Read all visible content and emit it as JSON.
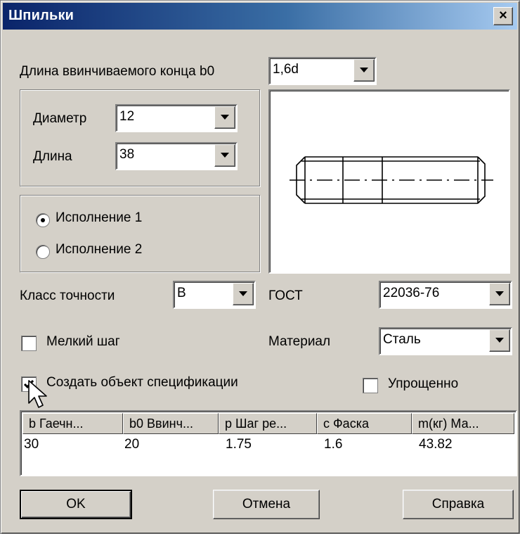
{
  "window": {
    "title": "Шпильки",
    "close_label": "×"
  },
  "b0": {
    "label": "Длина ввинчиваемого конца b0",
    "value": "1,6d"
  },
  "dims": {
    "diameter_label": "Диаметр",
    "diameter_value": "12",
    "length_label": "Длина",
    "length_value": "38"
  },
  "execution": {
    "option1": "Исполнение 1",
    "option2": "Исполнение 2",
    "selected": 1
  },
  "accuracy": {
    "label": "Класс точности",
    "value": "В"
  },
  "gost": {
    "label": "ГОСТ",
    "value": "22036-76"
  },
  "fine_pitch": {
    "label": "Мелкий шаг",
    "checked": false
  },
  "material": {
    "label": "Материал",
    "value": "Сталь"
  },
  "spec": {
    "label": "Создать объект спецификации",
    "checked": true
  },
  "simplified": {
    "label": "Упрощенно",
    "checked": false
  },
  "table": {
    "headers": [
      "b Гаечн...",
      "b0 Ввинч...",
      "p Шаг ре...",
      "c Фаска",
      "m(кг) Ма..."
    ],
    "row": [
      "30",
      "20",
      "1.75",
      "1.6",
      "43.82"
    ]
  },
  "buttons": {
    "ok": "OK",
    "cancel": "Отмена",
    "help": "Справка"
  },
  "icons": {
    "close": "close-icon",
    "dropdown": "chevron-down-icon",
    "check": "check-icon",
    "cursor": "mouse-pointer-icon"
  }
}
